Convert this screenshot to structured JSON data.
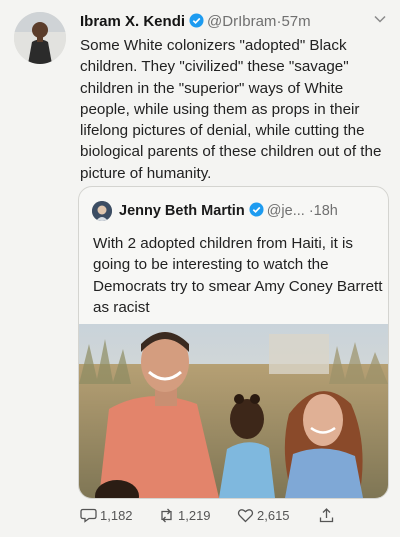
{
  "tweet": {
    "author_name": "Ibram X. Kendi",
    "handle": "@DrIbram",
    "separator": "·",
    "time": "57m",
    "text": "Some White colonizers \"adopted\" Black children. They \"civilized\" these \"savage\" children in the \"superior\" ways of White people, while using them as props in their lifelong pictures of denial, while cutting the biological parents of these children out of the picture of humanity."
  },
  "quoted_tweet": {
    "author_name": "Jenny Beth Martin",
    "handle": "@je...",
    "separator": "·",
    "time": "18h",
    "text": "With 2 adopted children from Haiti, it is going to be interesting to watch the Democrats try to smear Amy Coney Barrett as racist"
  },
  "actions": {
    "replies": "1,182",
    "retweets": "1,219",
    "likes": "2,615"
  },
  "colors": {
    "verified": "#1d9bf0",
    "text": "#222222",
    "muted": "#707070",
    "border": "#d4d4d0"
  },
  "icons": [
    "verified-badge-icon",
    "chevron-down-icon",
    "reply-icon",
    "retweet-icon",
    "like-icon",
    "share-icon"
  ]
}
